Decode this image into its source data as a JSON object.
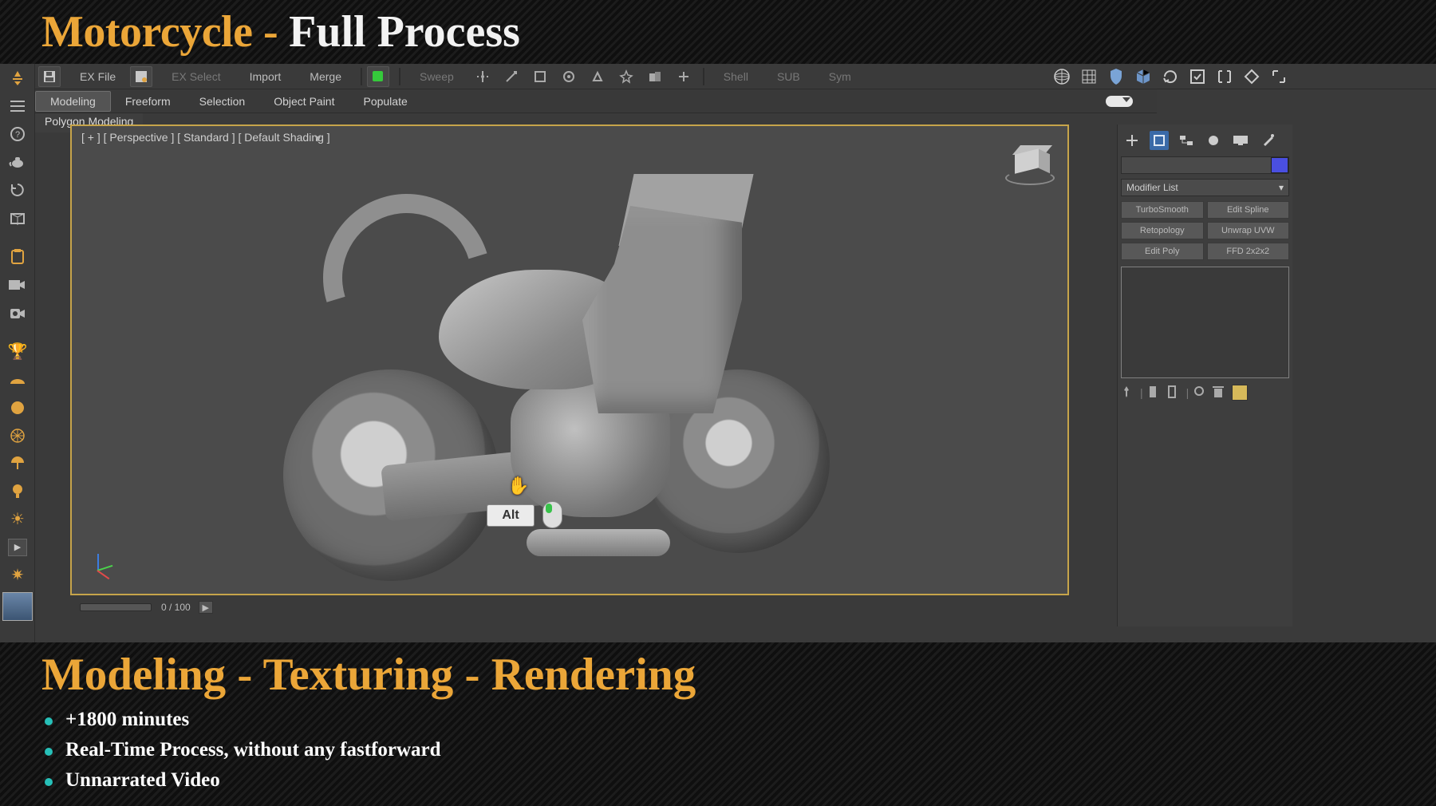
{
  "header": {
    "title_accent": "Motorcycle -",
    "title_white": "Full Process"
  },
  "toolbar": {
    "save_icon": "save",
    "ex_file": "EX File",
    "scene_icon": "scene",
    "ex_select": "EX Select",
    "import": "Import",
    "merge": "Merge",
    "green_toggle": "active",
    "sweep": "Sweep",
    "shell": "Shell",
    "sub": "SUB",
    "sym": "Sym"
  },
  "ribbon": {
    "tabs": [
      "Modeling",
      "Freeform",
      "Selection",
      "Object Paint",
      "Populate"
    ],
    "active": "Modeling",
    "sub": "Polygon Modeling"
  },
  "viewport": {
    "label": "[ + ] [ Perspective ] [ Standard ] [ Default Shading ]",
    "key_hint": "Alt"
  },
  "slider": {
    "frame": "0 / 100"
  },
  "rpanel": {
    "modifier_list": "Modifier List",
    "buttons": [
      "TurboSmooth",
      "Edit Spline",
      "Retopology",
      "Unwrap UVW",
      "Edit Poly",
      "FFD 2x2x2"
    ]
  },
  "footer": {
    "title": "Modeling - Texturing - Rendering",
    "bullets": [
      "+1800 minutes",
      "Real-Time Process, without any fastforward",
      "Unnarrated Video"
    ]
  }
}
